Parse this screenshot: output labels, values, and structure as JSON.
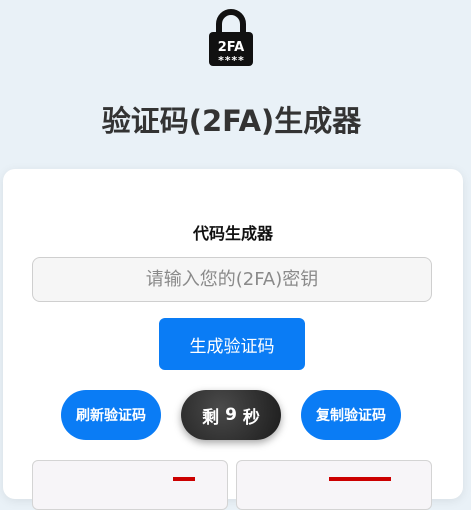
{
  "app": {
    "logo_icon": "padlock-icon",
    "logo_text": "2FA",
    "logo_stars": "****",
    "title": "验证码(2FA)生成器"
  },
  "generator": {
    "section_title": "代码生成器",
    "secret_placeholder": "请输入您的(2FA)密钥",
    "secret_value": "",
    "generate_label": "生成验证码",
    "refresh_label": "刷新验证码",
    "copy_label": "复制验证码",
    "timer_prefix": "剩",
    "timer_seconds": "9",
    "timer_suffix": "秒"
  },
  "colors": {
    "page_bg": "#e9f1f7",
    "accent": "#0a7cf5",
    "timer_bg": "#2a2a2a"
  }
}
